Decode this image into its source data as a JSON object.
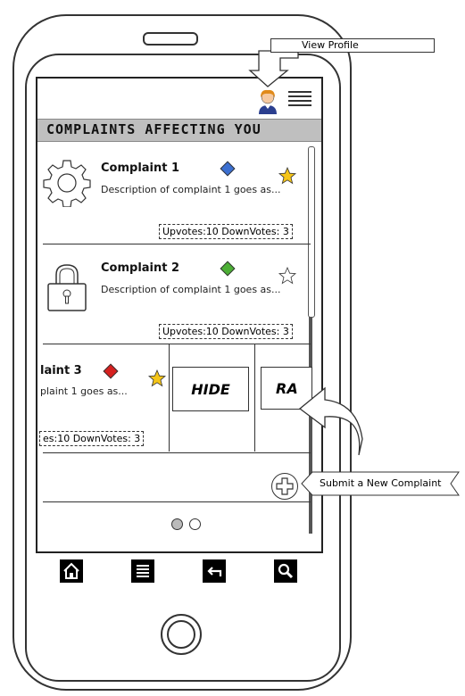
{
  "annotations": {
    "view_profile": "View Profile",
    "submit_new": "Submit a New Complaint"
  },
  "header": {
    "title": "COMPLAINTS AFFECTING YOU"
  },
  "complaints": [
    {
      "name": "Complaint 1",
      "description": "Description of complaint 1 goes as...",
      "votes": "Upvotes:10  DownVotes: 3",
      "icon": "gear-icon",
      "priority_color": "#3b6fd1",
      "starred": true
    },
    {
      "name": "Complaint 2",
      "description": "Description of complaint 1 goes as...",
      "votes": "Upvotes:10  DownVotes: 3",
      "icon": "lock-icon",
      "priority_color": "#4caf35",
      "starred": false
    },
    {
      "name": "laint 3",
      "description": "plaint 1 goes as...",
      "votes": "es:10  DownVotes: 3",
      "priority_color": "#d6201f",
      "starred": true
    }
  ],
  "swipe_actions": {
    "hide": "HIDE",
    "rate": "RA"
  },
  "pager": {
    "current": 1,
    "total": 2
  },
  "nav": [
    "home-icon",
    "list-icon",
    "back-icon",
    "search-icon"
  ],
  "colors": {
    "star": "#f5c518",
    "title_bg": "#bfbfbf"
  }
}
